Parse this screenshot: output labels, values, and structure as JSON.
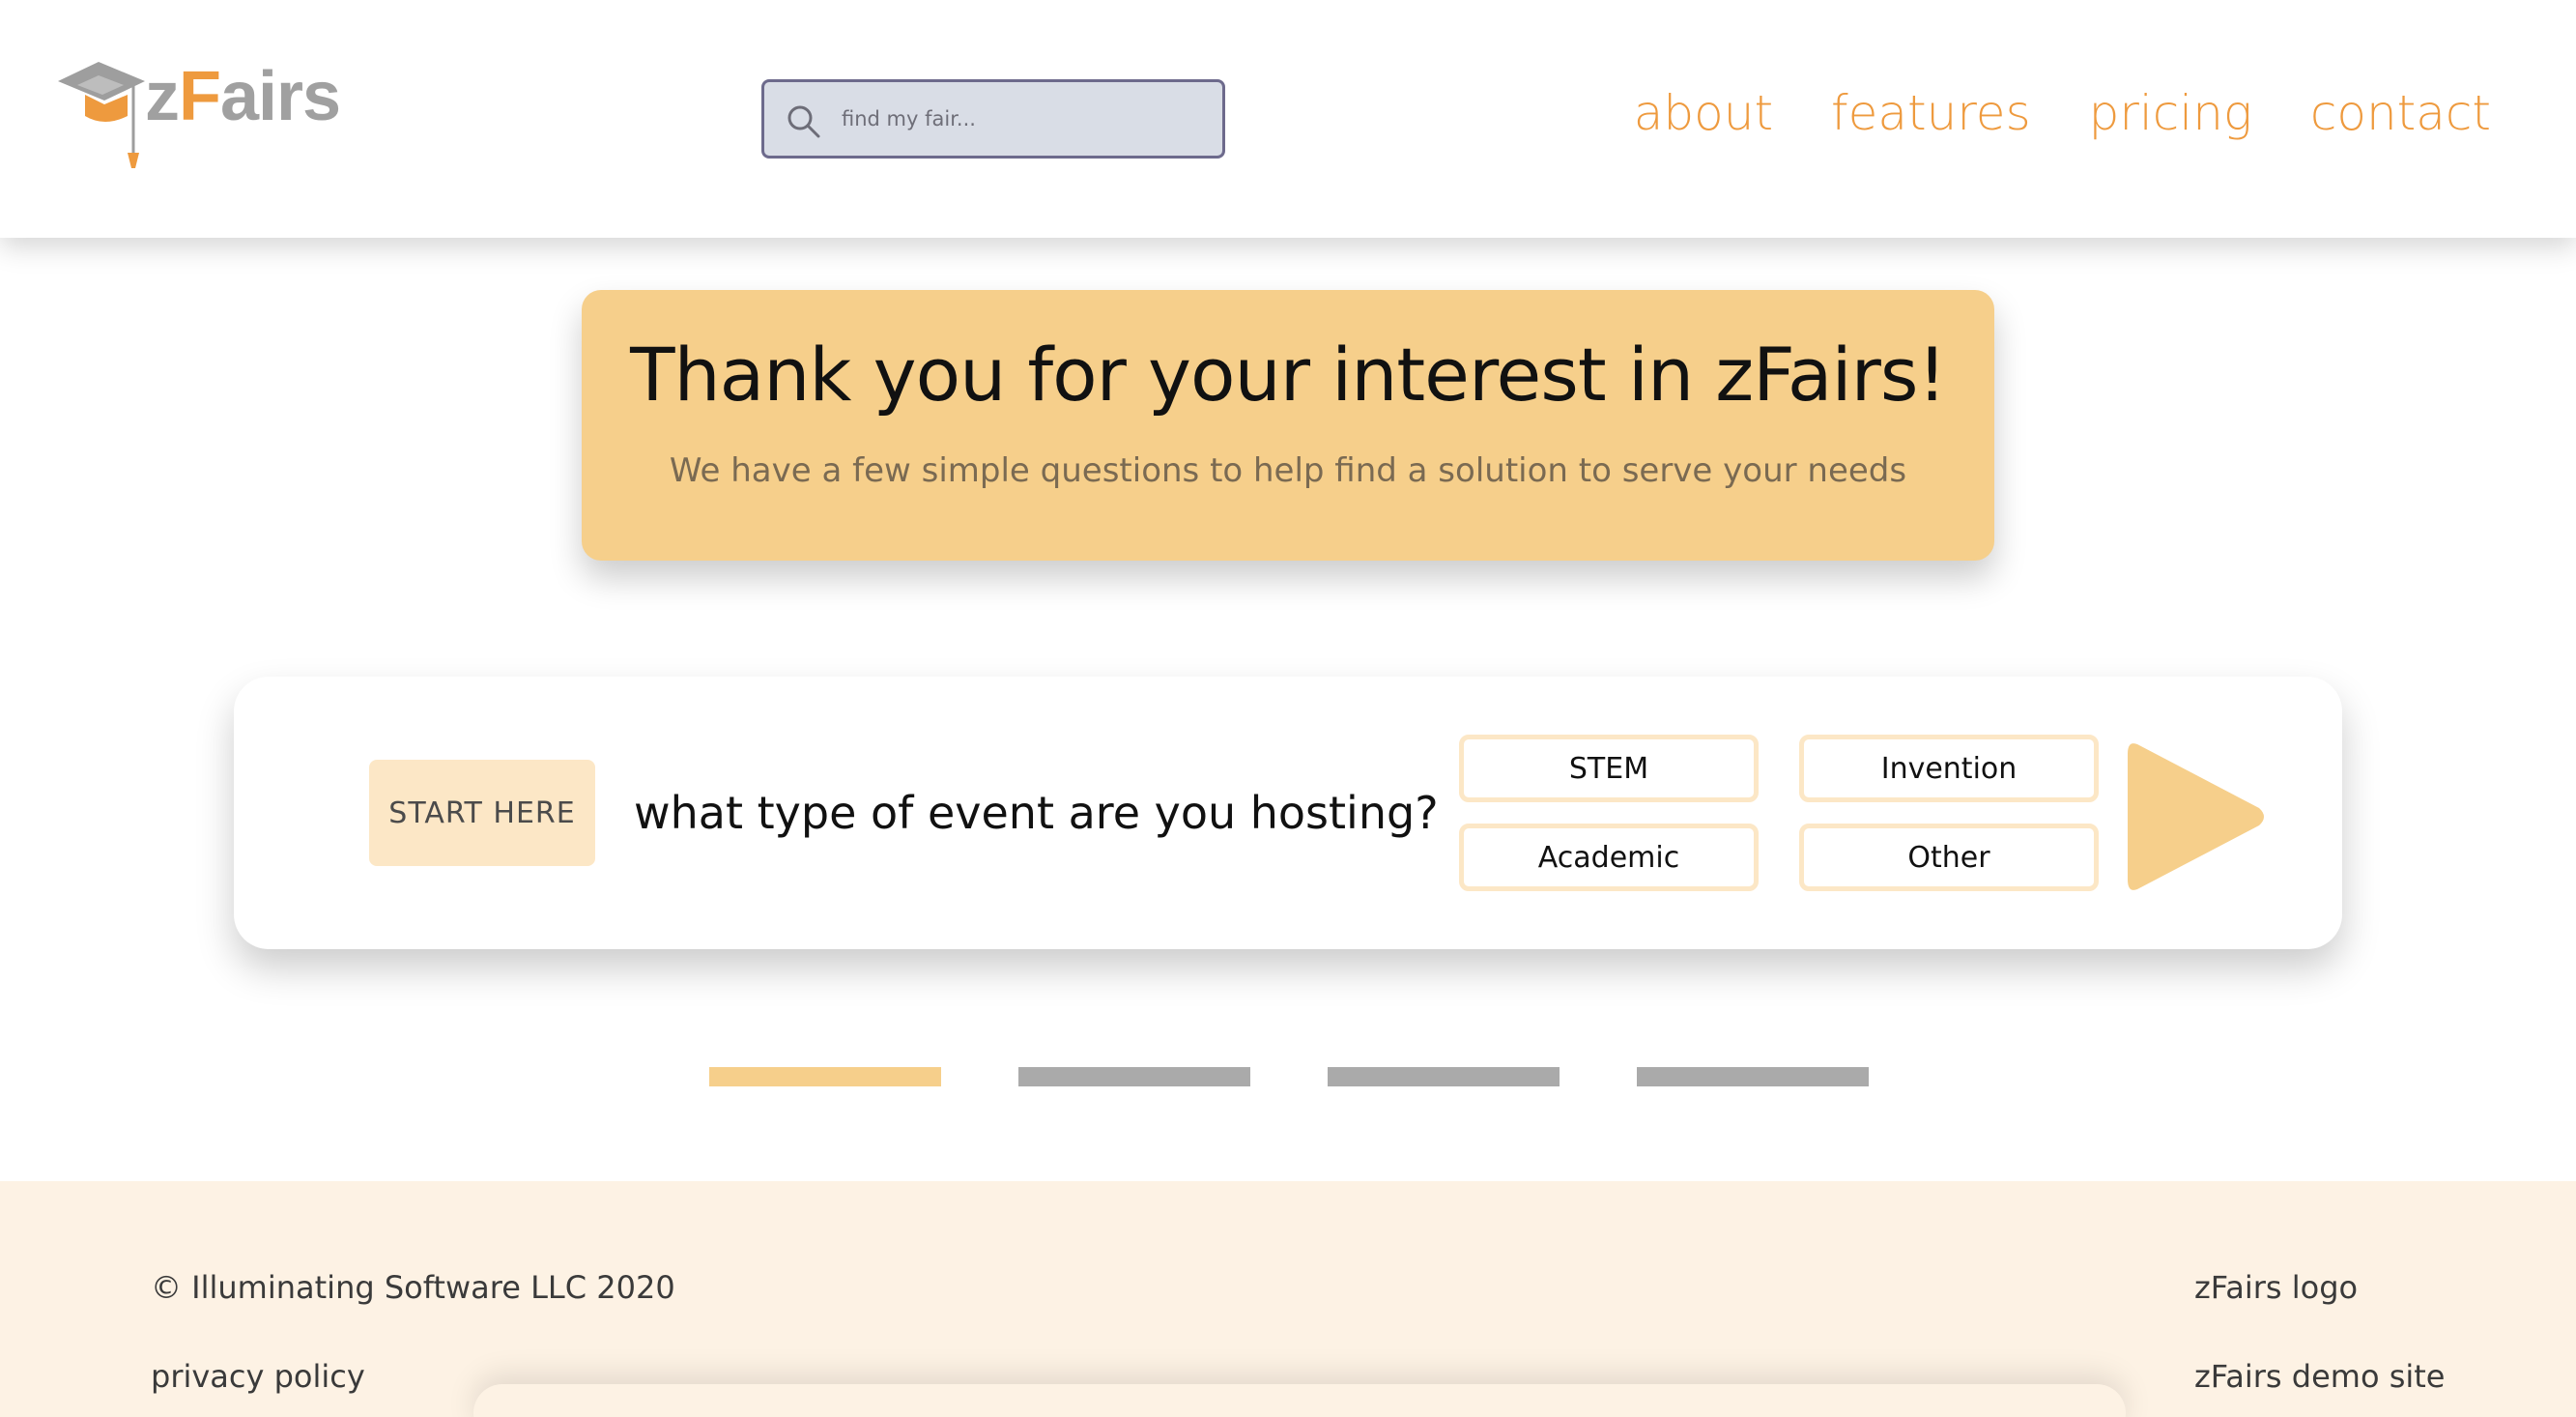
{
  "colors": {
    "accent": "#ee9a3e",
    "banner_bg": "#f6cf8b",
    "option_border": "#fce7c6",
    "footer_bg": "#fdf2e4",
    "progress_inactive": "#aaaaaa",
    "search_bg": "#d9dde6"
  },
  "header": {
    "logo": {
      "text_z": "z",
      "text_f": "F",
      "text_rest": "airs",
      "icon": "graduation-cap-icon"
    },
    "search": {
      "placeholder": "find my fair...",
      "value": "",
      "icon": "search-icon"
    },
    "nav": [
      {
        "label": "about"
      },
      {
        "label": "features"
      },
      {
        "label": "pricing"
      },
      {
        "label": "contact"
      }
    ]
  },
  "banner": {
    "title": "Thank you for your interest in zFairs!",
    "subtitle": "We have a few simple questions to help find a solution to serve your needs"
  },
  "question_card": {
    "tag": "START HERE",
    "question": "what type of event are you hosting?",
    "options": [
      {
        "label": "STEM"
      },
      {
        "label": "Invention"
      },
      {
        "label": "Academic"
      },
      {
        "label": "Other"
      }
    ],
    "next_icon": "play-arrow-icon"
  },
  "progress": {
    "current_step": 1,
    "total_steps": 4
  },
  "footer": {
    "copyright": "© Illuminating Software LLC 2020",
    "privacy": "privacy policy",
    "logo_link": "zFairs logo",
    "demo_link": "zFairs demo site"
  }
}
